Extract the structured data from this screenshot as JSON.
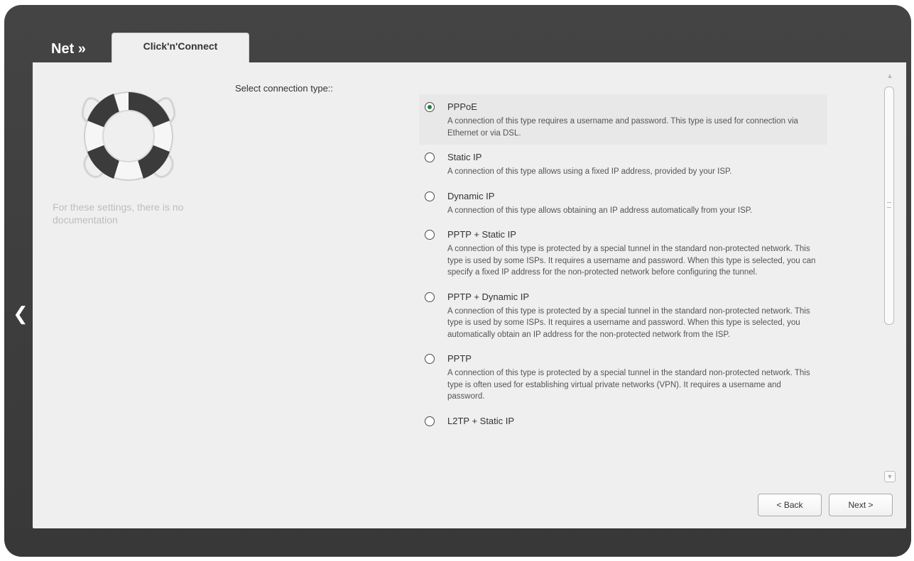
{
  "header": {
    "breadcrumb": "Net »",
    "tab_label": "Click'n'Connect"
  },
  "sidebar": {
    "nodoc_text": "For these settings, there is no documentation"
  },
  "main": {
    "select_label": "Select connection type::",
    "options": [
      {
        "title": "PPPoE",
        "description": "A connection of this type requires a username and password. This type is used for connection via Ethernet or via DSL."
      },
      {
        "title": "Static IP",
        "description": "A connection of this type allows using a fixed IP address, provided by your ISP."
      },
      {
        "title": "Dynamic IP",
        "description": "A connection of this type allows obtaining an IP address automatically from your ISP."
      },
      {
        "title": "PPTP + Static IP",
        "description": "A connection of this type is protected by a special tunnel in the standard non-protected network. This type is used by some ISPs. It requires a username and password. When this type is selected, you can specify a fixed IP address for the non-protected network before configuring the tunnel."
      },
      {
        "title": "PPTP + Dynamic IP",
        "description": "A connection of this type is protected by a special tunnel in the standard non-protected network. This type is used by some ISPs. It requires a username and password. When this type is selected, you automatically obtain an IP address for the non-protected network from the ISP."
      },
      {
        "title": "PPTP",
        "description": "A connection of this type is protected by a special tunnel in the standard non-protected network. This type is often used for establishing virtual private networks (VPN). It requires a username and password."
      },
      {
        "title": "L2TP + Static IP",
        "description": ""
      }
    ],
    "selected_option": "PPPoE"
  },
  "buttons": {
    "back_label": "< Back",
    "next_label": "Next >"
  },
  "icons": {
    "left_arrow": "chevron-left-icon",
    "lifebuoy": "lifebuoy-icon",
    "scroll_up": "scroll-up-icon",
    "scroll_down": "scroll-down-icon"
  },
  "colors": {
    "frame": "#3e3e3e",
    "panel": "#efefef",
    "radio_checked": "#2a7d3a"
  }
}
